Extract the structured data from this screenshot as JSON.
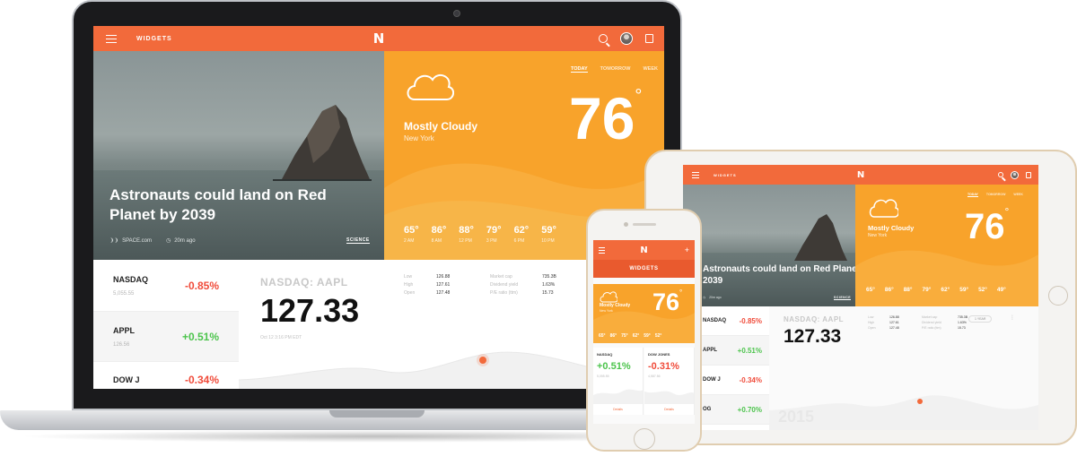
{
  "laptop": {
    "topbar": {
      "title": "WIDGETS",
      "logo": "N"
    },
    "hero": {
      "headline": "Astronauts could land on Red Planet by 2039",
      "source": "SPACE.com",
      "time": "20m ago",
      "tag": "SCIENCE"
    },
    "weather": {
      "tabs": [
        "TODAY",
        "TOMORROW",
        "WEEK"
      ],
      "temp": "76",
      "degree": "°",
      "condition": "Mostly Cloudy",
      "city": "New York",
      "forecast": [
        {
          "temp": "65°",
          "time": "2 AM"
        },
        {
          "temp": "86°",
          "time": "8 AM"
        },
        {
          "temp": "88°",
          "time": "12 PM"
        },
        {
          "temp": "79°",
          "time": "3 PM"
        },
        {
          "temp": "62°",
          "time": "6 PM"
        },
        {
          "temp": "59°",
          "time": "10 PM"
        }
      ]
    },
    "stocks": [
      {
        "name": "NASDAQ",
        "sub": "5,055.55",
        "change": "-0.85%",
        "dir": "neg"
      },
      {
        "name": "APPL",
        "sub": "126.56",
        "change": "+0.51%",
        "dir": "pos"
      },
      {
        "name": "DOW J",
        "sub": "",
        "change": "-0.34%",
        "dir": "neg"
      }
    ],
    "detail": {
      "ticker": "NASDAQ: AAPL",
      "price": "127.33",
      "date": "Oct 12 3:16 PM EDT",
      "stats": [
        {
          "k": "Low",
          "v": "126.88"
        },
        {
          "k": "Market cap",
          "v": "735.3B"
        },
        {
          "k": "High",
          "v": "127.61"
        },
        {
          "k": "Dividend yield",
          "v": "1.63%"
        },
        {
          "k": "Open",
          "v": "127.48"
        },
        {
          "k": "P/E ratio (ttm)",
          "v": "15.73"
        }
      ]
    }
  },
  "tablet": {
    "topbar": {
      "title": "WIDGETS",
      "logo": "N"
    },
    "hero": {
      "headline": "Astronauts could land on Red Planet by 2039",
      "tag": "SCIENCE",
      "time": "20m ago"
    },
    "weather": {
      "tabs": [
        "TODAY",
        "TOMORROW",
        "WEEK"
      ],
      "temp": "76",
      "degree": "°",
      "condition": "Mostly Cloudy",
      "city": "New York",
      "forecast": [
        "65°",
        "86°",
        "88°",
        "79°",
        "62°",
        "59°",
        "52°",
        "49°"
      ]
    },
    "stocks": [
      {
        "name": "NASDAQ",
        "change": "-0.85%",
        "dir": "neg"
      },
      {
        "name": "APPL",
        "change": "+0.51%",
        "dir": "pos"
      },
      {
        "name": "DOW J",
        "change": "-0.34%",
        "dir": "neg"
      },
      {
        "name": "OG",
        "change": "+0.70%",
        "dir": "pos"
      }
    ],
    "detail": {
      "ticker": "NASDAQ: AAPL",
      "price": "127.33",
      "range_button": "1 YEAR",
      "stats": [
        {
          "k": "Low",
          "v": "126.88"
        },
        {
          "k": "Market cap",
          "v": "735.3B"
        },
        {
          "k": "High",
          "v": "127.61"
        },
        {
          "k": "Dividend yield",
          "v": "1.63%"
        },
        {
          "k": "Open",
          "v": "127.48"
        },
        {
          "k": "P/E ratio (ttm)",
          "v": "15.73"
        }
      ],
      "watermark": "2015"
    }
  },
  "phone": {
    "topbar": {
      "logo": "N",
      "add": "+"
    },
    "subbar": "WIDGETS",
    "weather": {
      "temp": "76",
      "degree": "°",
      "condition": "Mostly Cloudy",
      "city": "New York",
      "forecast": [
        "65°",
        "86°",
        "75°",
        "62°",
        "59°",
        "52°"
      ]
    },
    "cards": [
      {
        "title": "NASDAQ",
        "value": "+0.51%",
        "sub": "5,055.55",
        "dir": "pos",
        "button": "Details"
      },
      {
        "title": "DOW JONES",
        "value": "-0.31%",
        "sub": "4,587.56",
        "dir": "neg",
        "button": "Details"
      }
    ]
  },
  "colors": {
    "brand_orange": "#f26a3b",
    "weather_orange": "#f8a32b",
    "negative": "#f04b3a",
    "positive": "#4cc44c"
  },
  "icons": [
    "menu-icon",
    "search-icon",
    "avatar",
    "bookmark-icon",
    "cloud-icon",
    "sound-icon",
    "clock-icon",
    "add-icon",
    "more-icon"
  ]
}
